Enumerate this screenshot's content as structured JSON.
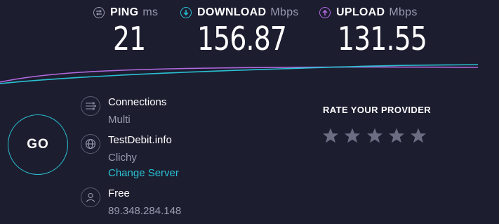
{
  "metrics": {
    "ping": {
      "label": "PING",
      "unit": "ms",
      "value": "21",
      "icon": "ping-icon",
      "icon_color": "#9b9bb0"
    },
    "download": {
      "label": "DOWNLOAD",
      "unit": "Mbps",
      "value": "156.87",
      "icon": "download-arrow-icon",
      "icon_color": "#29c1d1"
    },
    "upload": {
      "label": "UPLOAD",
      "unit": "Mbps",
      "value": "131.55",
      "icon": "upload-arrow-icon",
      "icon_color": "#b36ae2"
    }
  },
  "go_button": {
    "label": "GO",
    "color": "#29c1d1"
  },
  "info": {
    "connections": {
      "title": "Connections",
      "value": "Multi",
      "icon": "connections-icon"
    },
    "server": {
      "title": "TestDebit.info",
      "location": "Clichy",
      "change_link": "Change Server",
      "icon": "globe-icon"
    },
    "isp": {
      "title": "Free",
      "ip": "89.348.284.148",
      "icon": "user-icon"
    }
  },
  "rating": {
    "title": "RATE YOUR PROVIDER",
    "stars": 5,
    "selected": 0,
    "star_color": "#6c6c82"
  },
  "colors": {
    "background": "#1d1d30",
    "accent": "#29c1d1",
    "upload": "#b36ae2",
    "muted": "#9b9bb0"
  }
}
